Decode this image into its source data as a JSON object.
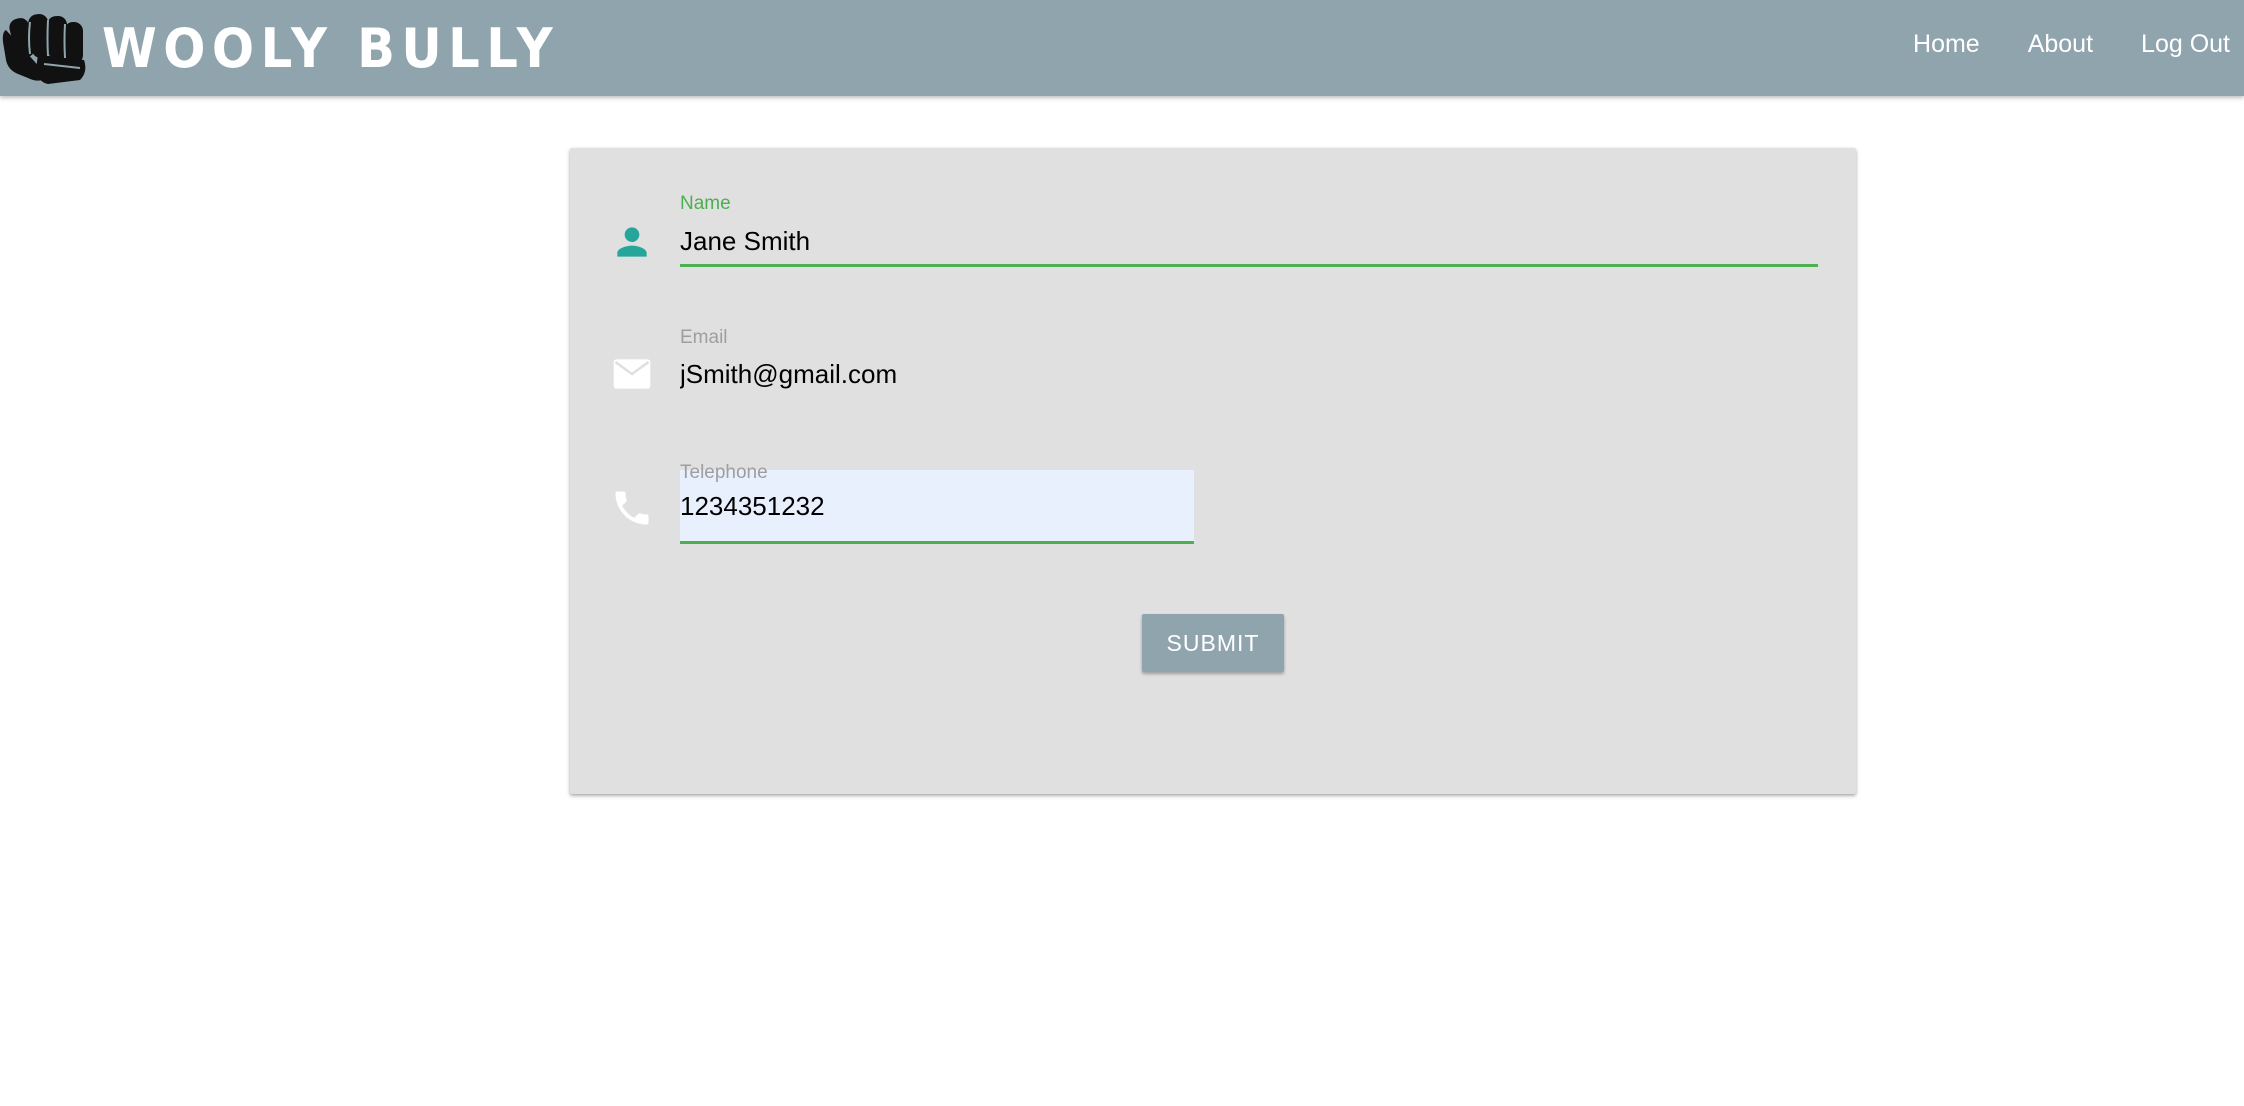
{
  "header": {
    "brand": "WOOLY BULLY",
    "logo_icon": "fist-icon",
    "nav": [
      {
        "label": "Home"
      },
      {
        "label": "About"
      },
      {
        "label": "Log Out"
      }
    ]
  },
  "form": {
    "fields": [
      {
        "icon": "person-icon",
        "label": "Name",
        "value": "Jane Smith",
        "focused": true
      },
      {
        "icon": "mail-icon",
        "label": "Email",
        "value": "jSmith@gmail.com",
        "focused": false
      },
      {
        "icon": "phone-icon",
        "label": "Telephone",
        "value": "1234351232",
        "focused": false,
        "autofilled": true
      }
    ],
    "submit_label": "SUBMIT"
  },
  "colors": {
    "navbar": "#90a4ae",
    "card": "#e0e0e0",
    "active_accent": "#4caf50",
    "active_icon": "#26a69a",
    "autofill_bg": "#e8f0fe"
  }
}
